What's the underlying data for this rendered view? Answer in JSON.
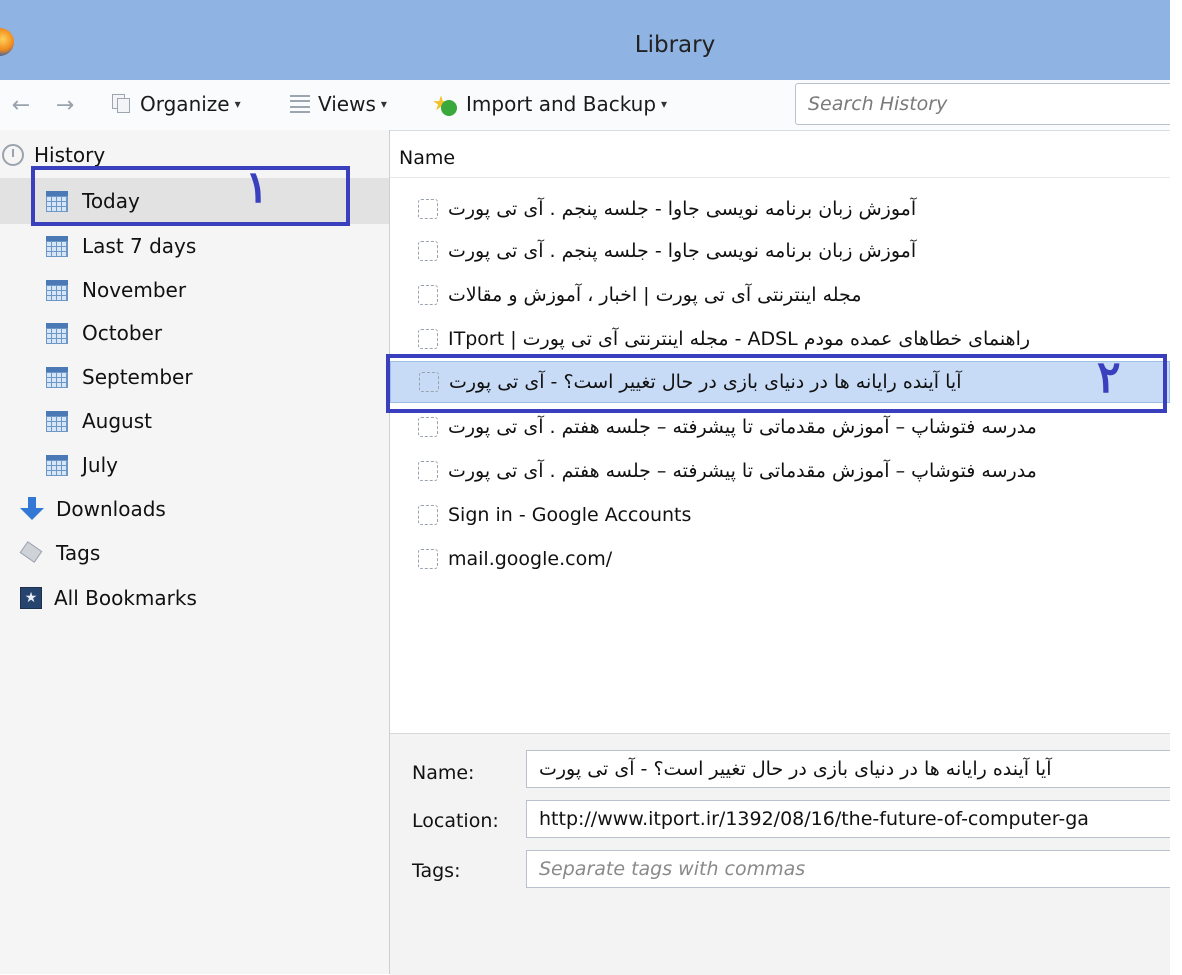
{
  "window": {
    "title": "Library"
  },
  "toolbar": {
    "back_icon": "back-arrow-icon",
    "forward_icon": "forward-arrow-icon",
    "organize_label": "Organize",
    "views_label": "Views",
    "import_label": "Import and Backup",
    "search_placeholder": "Search History"
  },
  "sidebar": {
    "history_label": "History",
    "items": [
      {
        "label": "Today",
        "icon": "calendar-icon"
      },
      {
        "label": "Last 7 days",
        "icon": "calendar-icon"
      },
      {
        "label": "November",
        "icon": "calendar-icon"
      },
      {
        "label": "October",
        "icon": "calendar-icon"
      },
      {
        "label": "September",
        "icon": "calendar-icon"
      },
      {
        "label": "August",
        "icon": "calendar-icon"
      },
      {
        "label": "July",
        "icon": "calendar-icon"
      }
    ],
    "downloads_label": "Downloads",
    "tags_label": "Tags",
    "bookmarks_label": "All Bookmarks"
  },
  "list": {
    "header_name": "Name",
    "rows": [
      "آموزش زبان برنامه نویسی جاوا - جلسه پنجم . آی تی پورت",
      "آموزش زبان برنامه نویسی جاوا - جلسه پنجم . آی تی پورت",
      "مجله اینترنتی آی تی پورت | اخبار ، آموزش و مقالات",
      "ITport | مجله اینترنتی آی تی پورت - ADSL راهنمای خطاهای عمده مودم",
      "آیا آینده رایانه ها در دنیای بازی در حال تغییر است؟ - آی تی پورت",
      "مدرسه فتوشاپ – آموزش مقدماتی تا پیشرفته – جلسه هفتم . آی تی پورت",
      "مدرسه فتوشاپ – آموزش مقدماتی تا پیشرفته – جلسه هفتم . آی تی پورت",
      "Sign in - Google Accounts",
      "mail.google.com/"
    ]
  },
  "details": {
    "name_label": "Name:",
    "name_value": "آیا آینده رایانه ها در دنیای بازی در حال تغییر است؟ - آی تی پورت",
    "location_label": "Location:",
    "location_value": "http://www.itport.ir/1392/08/16/the-future-of-computer-ga",
    "tags_label": "Tags:",
    "tags_placeholder": "Separate tags with commas"
  },
  "annotations": {
    "one": "۱",
    "two": "۲"
  },
  "colors": {
    "titlebar": "#8fb3e3",
    "selection": "#c8dbf6",
    "annotation": "#3a3fbe"
  }
}
